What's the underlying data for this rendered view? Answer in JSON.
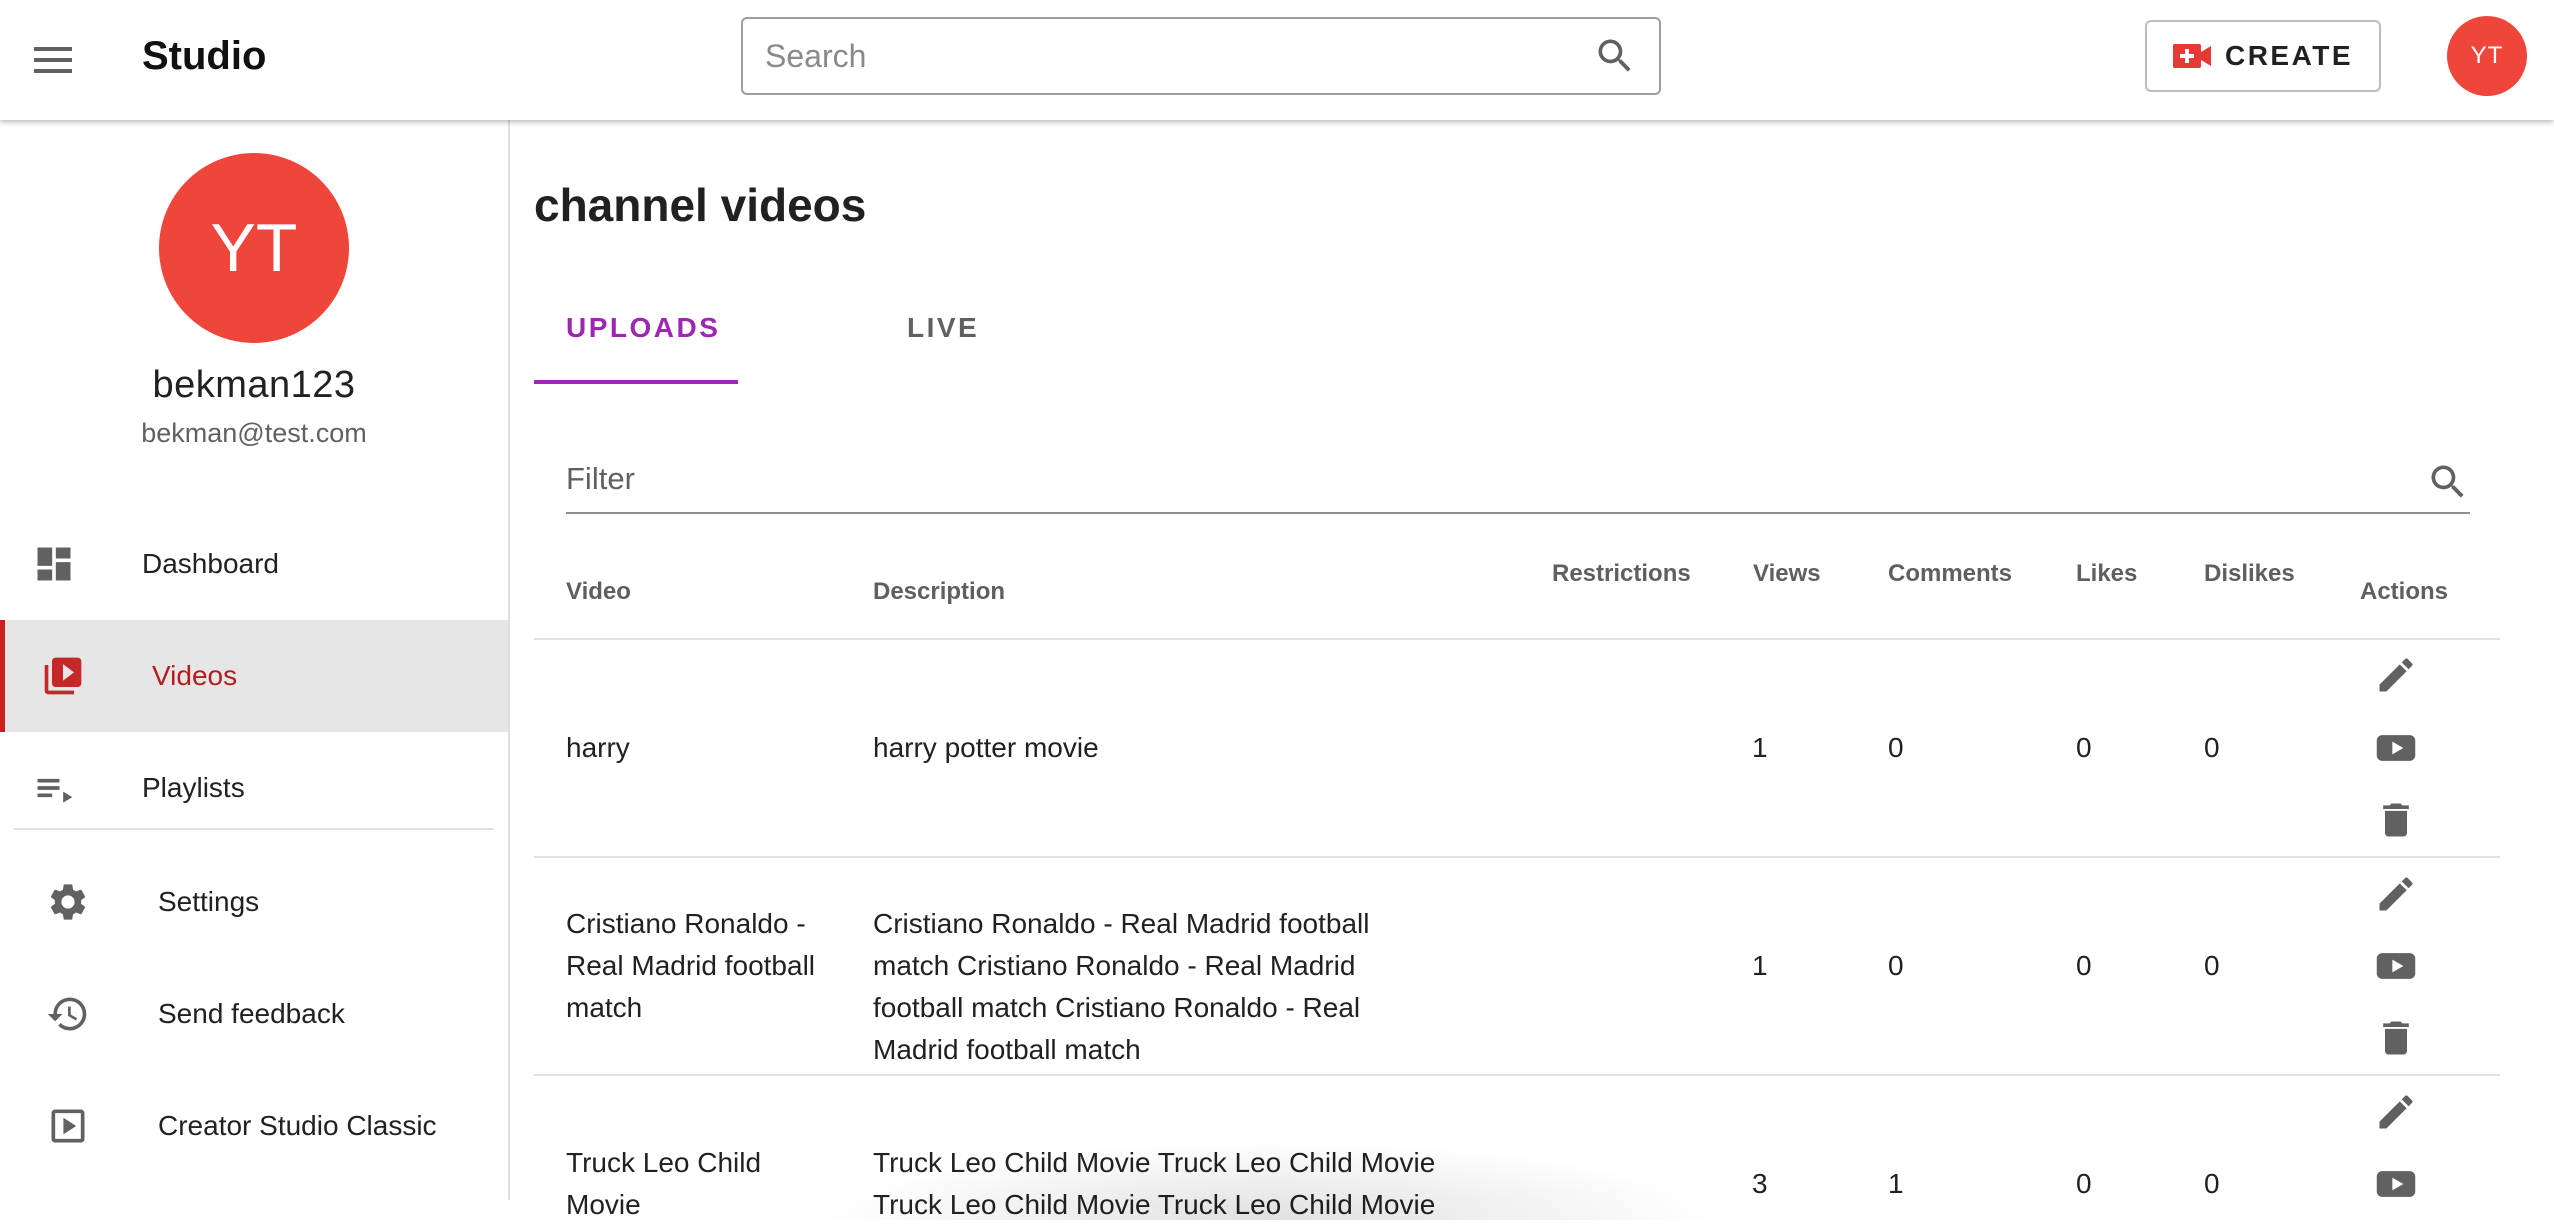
{
  "app": {
    "brand": "Studio",
    "search_placeholder": "Search",
    "create_label": "CREATE",
    "avatar_initials": "YT"
  },
  "colors": {
    "accent_red": "#f0453a",
    "active_nav": "#b51c1c",
    "tab_purple": "#9c27b0",
    "icon_grey": "#616161"
  },
  "sidebar": {
    "avatar_initials": "YT",
    "username": "bekman123",
    "email": "bekman@test.com",
    "items": [
      {
        "label": "Dashboard",
        "icon": "dashboard-icon"
      },
      {
        "label": "Videos",
        "icon": "video-library-icon",
        "active": true
      },
      {
        "label": "Playlists",
        "icon": "playlist-icon"
      }
    ],
    "secondary": [
      {
        "label": "Settings",
        "icon": "gear-icon"
      },
      {
        "label": "Send feedback",
        "icon": "history-icon"
      },
      {
        "label": "Creator Studio Classic",
        "icon": "play-box-icon"
      }
    ]
  },
  "main": {
    "title": "channel videos",
    "tabs": [
      {
        "label": "UPLOADS",
        "active": true
      },
      {
        "label": "LIVE",
        "active": false
      }
    ],
    "filter_placeholder": "Filter",
    "table": {
      "headers": {
        "video": "Video",
        "description": "Description",
        "restrictions": "Restrictions",
        "views": "Views",
        "comments": "Comments",
        "likes": "Likes",
        "dislikes": "Dislikes",
        "actions": "Actions"
      },
      "rows": [
        {
          "video": "harry",
          "description": "harry potter movie",
          "restrictions": "",
          "views": "1",
          "comments": "0",
          "likes": "0",
          "dislikes": "0"
        },
        {
          "video": "Cristiano Ronaldo - Real Madrid football match",
          "description": "Cristiano Ronaldo - Real Madrid football match Cristiano Ronaldo - Real Madrid football match Cristiano Ronaldo - Real Madrid football match",
          "restrictions": "",
          "views": "1",
          "comments": "0",
          "likes": "0",
          "dislikes": "0"
        },
        {
          "video": "Truck Leo Child Movie",
          "description": "Truck Leo Child Movie Truck Leo Child Movie Truck Leo Child Movie Truck Leo Child Movie",
          "restrictions": "",
          "views": "3",
          "comments": "1",
          "likes": "0",
          "dislikes": "0"
        }
      ]
    }
  }
}
